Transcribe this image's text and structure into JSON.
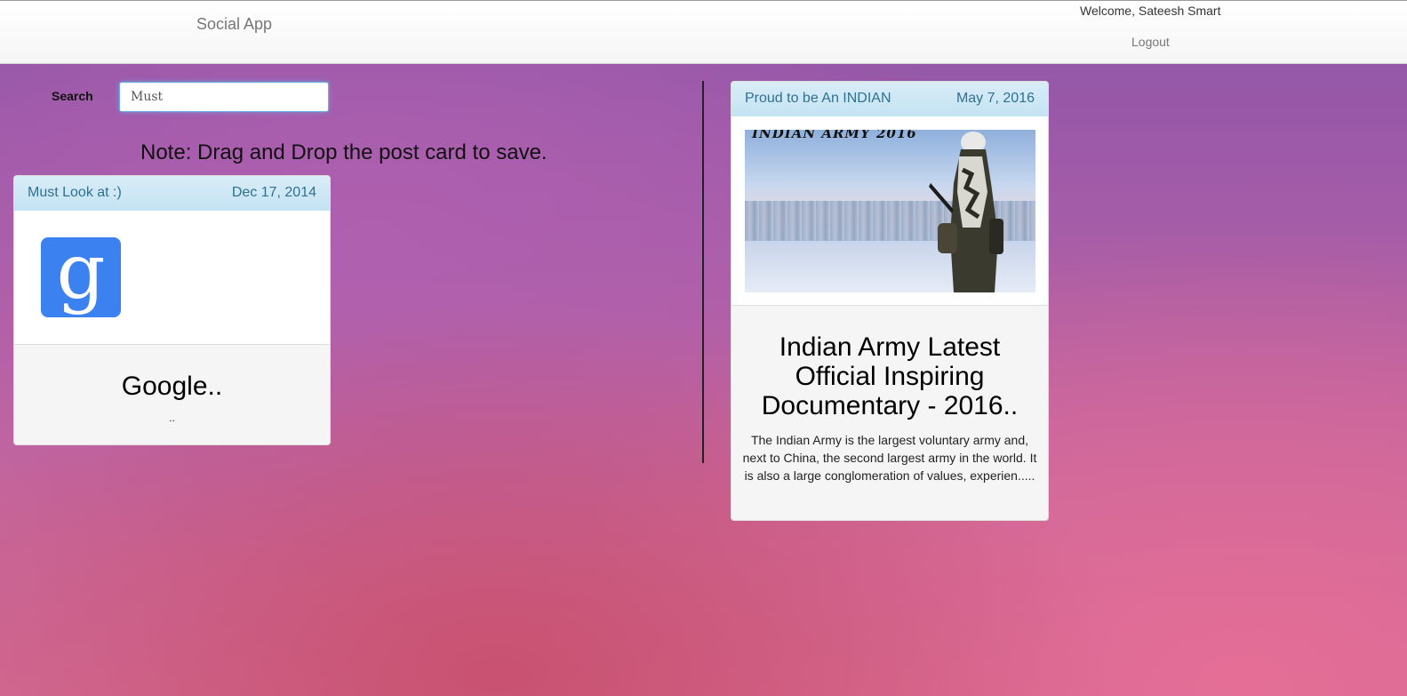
{
  "navbar": {
    "brand": "Social App",
    "welcome": "Welcome, Sateesh Smart",
    "logout": "Logout"
  },
  "search": {
    "label": "Search",
    "value": "Must"
  },
  "note": "Note: Drag and Drop the post card to save.",
  "results": [
    {
      "title": "Must Look at :)",
      "date": "Dec 17, 2014",
      "image_icon": "google-g-logo",
      "heading": "Google..",
      "description": ".."
    }
  ],
  "saved": [
    {
      "title": "Proud to be An INDIAN",
      "date": "May 7, 2016",
      "image_caption": "INDIAN ARMY 2016",
      "heading": "Indian Army Latest Official Inspiring Documentary - 2016..",
      "description": "The Indian Army is the largest voluntary army and, next to China, the second largest army in the world. It is also a large conglomeration of values, experien....."
    }
  ],
  "colors": {
    "card_header_bg": "#d9edf7",
    "card_header_text": "#31708f",
    "google_blue": "#3b82f0",
    "focus_ring": "#66afe9"
  }
}
